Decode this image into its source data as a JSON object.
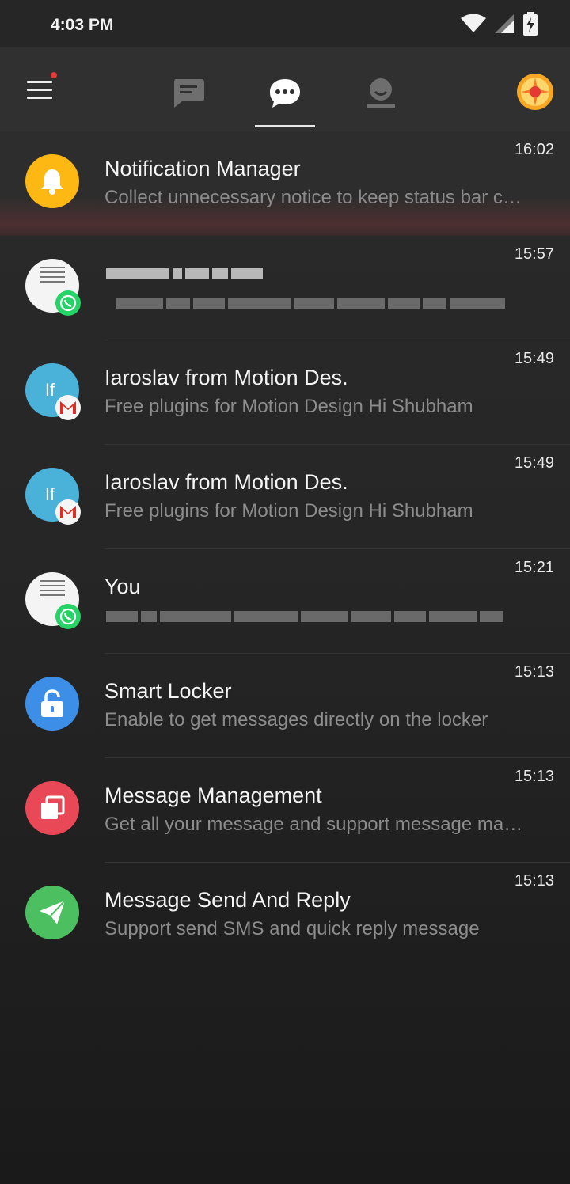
{
  "status_bar": {
    "time": "4:03 PM"
  },
  "app_bar": {
    "tabs": [
      {
        "name": "messages-tab",
        "icon": "chat-bubble-icon"
      },
      {
        "name": "conversations-tab",
        "icon": "chat-dots-icon",
        "selected": true
      },
      {
        "name": "contacts-tab",
        "icon": "person-icon"
      }
    ]
  },
  "colors": {
    "accent_yellow": "#FDB813",
    "accent_blue": "#4AB1D8",
    "accent_red": "#E94857",
    "accent_green": "#4CC061",
    "lock_blue": "#3C8EE6"
  },
  "conversations": [
    {
      "title": "Notification Manager",
      "subtitle": "Collect unnecessary notice to keep status bar clean",
      "time": "16:02"
    },
    {
      "title": "",
      "subtitle": "",
      "time": "15:57"
    },
    {
      "title": "Iaroslav from Motion Des.",
      "subtitle": "Free plugins for Motion Design   Hi Shubham",
      "time": "15:49"
    },
    {
      "title": "Iaroslav from Motion Des.",
      "subtitle": "Free plugins for Motion Design   Hi Shubham",
      "time": "15:49"
    },
    {
      "title": "You",
      "subtitle": "",
      "time": "15:21"
    },
    {
      "title": "Smart Locker",
      "subtitle": "Enable to get messages directly on the locker",
      "time": "15:13"
    },
    {
      "title": "Message Management",
      "subtitle": "Get all your message and support message management",
      "time": "15:13"
    },
    {
      "title": "Message Send And Reply",
      "subtitle": "Support send SMS and quick reply message",
      "time": "15:13"
    }
  ]
}
